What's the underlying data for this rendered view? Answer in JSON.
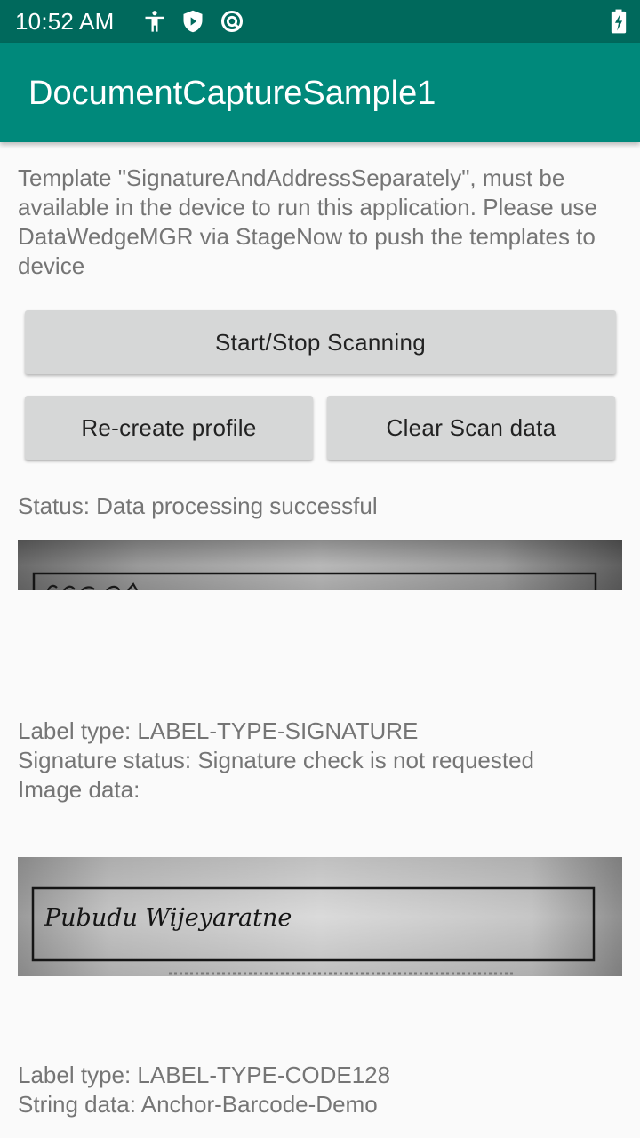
{
  "status_bar": {
    "time": "10:52 AM",
    "icons": [
      "accessibility-icon",
      "shield-icon",
      "data-saver-icon",
      "battery-charging-icon"
    ]
  },
  "app_bar": {
    "title": "DocumentCaptureSample1"
  },
  "info": {
    "text": "Template \"SignatureAndAddressSeparately\", must be available in the device to run this application. Please use DataWedgeMGR via StageNow to push the templates to device"
  },
  "buttons": {
    "start_stop": "Start/Stop Scanning",
    "recreate_profile": "Re-create profile",
    "clear_scan_data": "Clear Scan data"
  },
  "status": {
    "text": "Status: Data processing successful"
  },
  "results": [
    {
      "label_type": "Label type: LABEL-TYPE-SIGNATURE",
      "signature_status": "Signature status: Signature check is not requested",
      "image_data": "Image data:"
    },
    {
      "signature_text": "Pubudu Wijeyaratne",
      "label_type": "Label type: LABEL-TYPE-CODE128",
      "string_data": "String data: Anchor-Barcode-Demo"
    }
  ],
  "colors": {
    "status_bar": "#00695c",
    "app_bar": "#00897b",
    "background": "#fafafa",
    "button": "#d6d7d7",
    "secondary_text": "#757575"
  }
}
